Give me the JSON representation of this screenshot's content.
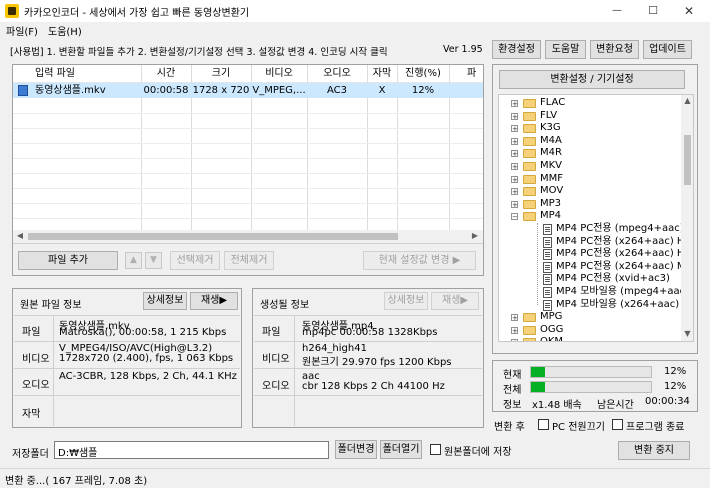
{
  "window": {
    "title": "카카오인코더 - 세상에서 가장 쉽고 빠른 동영상변환기",
    "controls": {
      "minimize": "—",
      "maximize": "☐",
      "close": "✕"
    }
  },
  "menu": [
    {
      "label": "파일(F)"
    },
    {
      "label": "도움(H)"
    }
  ],
  "usage": {
    "text": "[사용법] 1. 변환할 파일들 추가  2. 변환설정/기기설정 선택  3. 설정값 변경  4. 인코딩 시작 클릭",
    "version": "Ver 1.95"
  },
  "toolbar": {
    "env": "환경설정",
    "help": "도움말",
    "request": "변환요청",
    "update": "업데이트"
  },
  "file_table": {
    "headers": [
      "입력 파일",
      "시간",
      "크기",
      "비디오",
      "오디오",
      "자막",
      "진행(%)",
      "파"
    ],
    "rows": [
      {
        "name": "동영상샘플.mkv",
        "time": "00:00:58",
        "size": "1728 x 720",
        "video": "V_MPEG,...",
        "audio": "AC3",
        "sub": "X",
        "progress": "12%"
      }
    ]
  },
  "file_buttons": {
    "add": "파일 추가",
    "up": "▲",
    "down": "▼",
    "remove_sel": "선택제거",
    "remove_all": "전체제거",
    "change": "현재 설정값 변경  ▶"
  },
  "source_info": {
    "title": "원본 파일 정보",
    "detail_btn": "상세정보",
    "play_btn": "재생▶",
    "rows": [
      {
        "label": "파일",
        "lines": [
          "동영상샘플.mkv",
          "Matroska(), 00:00:58, 1 215 Kbps"
        ]
      },
      {
        "label": "비디오",
        "lines": [
          "V_MPEG4/ISO/AVC(High@L3.2)",
          "1728x720 (2.400),  fps, 1 063 Kbps"
        ]
      },
      {
        "label": "오디오",
        "lines": [
          "AC-3CBR, 128 Kbps, 2 Ch, 44.1 KHz"
        ]
      },
      {
        "label": "자막",
        "lines": []
      }
    ]
  },
  "output_info": {
    "title": "생성될 정보",
    "detail_btn": "상세정보",
    "play_btn": "재생▶",
    "rows": [
      {
        "label": "파일",
        "lines": [
          "동영상샘플.mp4",
          "mp4pc  00:00:58  1328Kbps"
        ]
      },
      {
        "label": "비디오",
        "lines": [
          "h264_high41",
          "원본크기  29.970 fps   1200 Kbps"
        ]
      },
      {
        "label": "오디오",
        "lines": [
          "aac",
          "cbr     128 Kbps   2 Ch   44100 Hz"
        ]
      }
    ]
  },
  "settings_button": "변환설정 / 기기설정",
  "tree": [
    {
      "label": "FLAC",
      "level": 0,
      "expand": "+"
    },
    {
      "label": "FLV",
      "level": 0,
      "expand": "+"
    },
    {
      "label": "K3G",
      "level": 0,
      "expand": "+"
    },
    {
      "label": "M4A",
      "level": 0,
      "expand": "+"
    },
    {
      "label": "M4R",
      "level": 0,
      "expand": "+"
    },
    {
      "label": "MKV",
      "level": 0,
      "expand": "+"
    },
    {
      "label": "MMF",
      "level": 0,
      "expand": "+"
    },
    {
      "label": "MOV",
      "level": 0,
      "expand": "+"
    },
    {
      "label": "MP3",
      "level": 0,
      "expand": "+"
    },
    {
      "label": "MP4",
      "level": 0,
      "expand": "−"
    },
    {
      "label": "MP4 PC전용 (mpeg4+aac) -",
      "level": 1,
      "expand": ""
    },
    {
      "label": "MP4 PC전용 (x264+aac) Hig",
      "level": 1,
      "expand": ""
    },
    {
      "label": "MP4 PC전용 (x264+aac) Hig",
      "level": 1,
      "expand": ""
    },
    {
      "label": "MP4 PC전용 (x264+aac) Ma",
      "level": 1,
      "expand": ""
    },
    {
      "label": "MP4 PC전용 (xvid+ac3)",
      "level": 1,
      "expand": ""
    },
    {
      "label": "MP4 모바일용 (mpeg4+aac)",
      "level": 1,
      "expand": ""
    },
    {
      "label": "MP4 모바일용 (x264+aac) Ba",
      "level": 1,
      "expand": ""
    },
    {
      "label": "MPG",
      "level": 0,
      "expand": "+"
    },
    {
      "label": "OGG",
      "level": 0,
      "expand": "+"
    },
    {
      "label": "OKM",
      "level": 0,
      "expand": "+"
    }
  ],
  "progress": {
    "current_label": "현재",
    "current_value": 0.12,
    "current_text": "12%",
    "total_label": "전체",
    "total_value": 0.12,
    "total_text": "12%",
    "info_label": "정보",
    "speed": "x1.48 배속",
    "remain_label": "남은시간",
    "remain": "00:00:34"
  },
  "after": {
    "label": "변환 후",
    "pc_off": "PC 전원끄기",
    "quit": "프로그램 종료"
  },
  "save": {
    "label": "저장폴더",
    "path": "D:₩샘플",
    "change_btn": "폴더변경",
    "open_btn": "폴더열기",
    "same_folder": "원본폴더에 저장"
  },
  "stop_button": "변환 중지",
  "status": "변환 중...( 167 프레임,  7.08 초)",
  "colors": {
    "progress": "#06b025",
    "selection": "#cce8ff",
    "folder": "#f5d27a"
  }
}
